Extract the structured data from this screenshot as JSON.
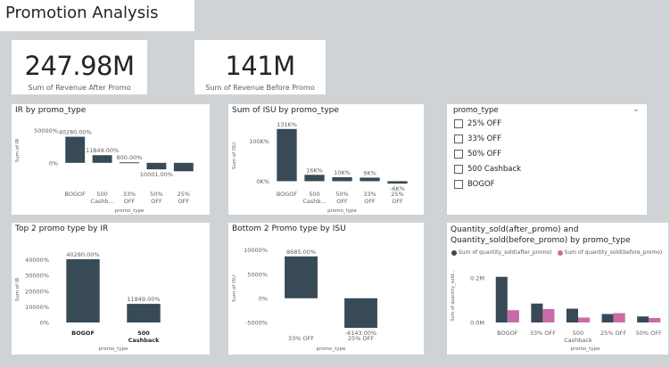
{
  "page_title": "Promotion Analysis",
  "kpis": [
    {
      "value": "247.98M",
      "label": "Sum of Revenue After Promo"
    },
    {
      "value": "141M",
      "label": "Sum of Revenue Before Promo"
    }
  ],
  "slicer": {
    "title": "promo_type",
    "items": [
      "25% OFF",
      "33% OFF",
      "50% OFF",
      "500 Cashback",
      "BOGOF"
    ]
  },
  "colors": {
    "dark": "#374a56",
    "pink": "#c96ba6",
    "axis_text": "#605e5c"
  },
  "chart_data": [
    {
      "id": "ir_by_promo",
      "type": "bar",
      "title": "IR by promo_type",
      "xlabel": "promo_type",
      "ylabel": "Sum of IR",
      "categories": [
        "BOGOF",
        "500 Cashb...",
        "33% OFF",
        "50% OFF",
        "25% OFF"
      ],
      "values": [
        40280,
        11849,
        800,
        -10001,
        -13000
      ],
      "data_labels": [
        "40280.00%",
        "11849.00%",
        "800.00%",
        "10001.00%",
        ""
      ],
      "yticks": [
        "50000%",
        "0%"
      ],
      "ylim": [
        -14000,
        52000
      ]
    },
    {
      "id": "isu_by_promo",
      "type": "bar",
      "title": "Sum of ISU by promo_type",
      "xlabel": "promo_type",
      "ylabel": "Sum of ISU",
      "categories": [
        "BOGOF",
        "500 Cashb...",
        "50% OFF",
        "33% OFF",
        "25% OFF"
      ],
      "values": [
        131000,
        16000,
        10000,
        9000,
        -6000
      ],
      "data_labels": [
        "131K%",
        "16K%",
        "10K%",
        "9K%",
        "-6K%"
      ],
      "yticks": [
        "100K%",
        "0K%"
      ],
      "ylim": [
        -8000,
        135000
      ]
    },
    {
      "id": "top2_ir",
      "type": "bar",
      "title": "Top 2 promo type by IR",
      "xlabel": "promo_type",
      "ylabel": "Sum of IR",
      "categories": [
        "BOGOF",
        "500 Cashback"
      ],
      "values": [
        40280,
        11849
      ],
      "data_labels": [
        "40280.00%",
        "11849.00%"
      ],
      "yticks": [
        "40000%",
        "30000%",
        "20000%",
        "10000%",
        "0%"
      ],
      "ylim": [
        0,
        42000
      ]
    },
    {
      "id": "bottom2_isu",
      "type": "bar",
      "title": "Bottom 2 Promo type by ISU",
      "xlabel": "promo_type",
      "ylabel": "Sum of ISU",
      "categories": [
        "33% OFF",
        "25% OFF"
      ],
      "values": [
        8685,
        -6143
      ],
      "data_labels": [
        "8685.00%",
        "-6143.00%"
      ],
      "yticks": [
        "10000%",
        "5000%",
        "0%",
        "-5000%"
      ],
      "ylim": [
        -6500,
        10500
      ]
    },
    {
      "id": "qty_sold",
      "type": "bar",
      "title": "Quantity_sold(after_promo) and Quantity_sold(before_promo) by promo_type",
      "xlabel": "promo_type",
      "ylabel": "Sum of quantity_sold...",
      "categories": [
        "BOGOF",
        "33% OFF",
        "500 Cashback",
        "25% OFF",
        "50% OFF"
      ],
      "series": [
        {
          "name": "Sum of quantity_sold(after_promo)",
          "values": [
            0.205,
            0.085,
            0.062,
            0.038,
            0.027
          ]
        },
        {
          "name": "Sum of quantity_sold(before_promo)",
          "values": [
            0.055,
            0.06,
            0.022,
            0.042,
            0.02
          ]
        }
      ],
      "yticks": [
        "0.2M",
        "0.0M"
      ],
      "ylim": [
        0,
        0.24
      ]
    }
  ]
}
